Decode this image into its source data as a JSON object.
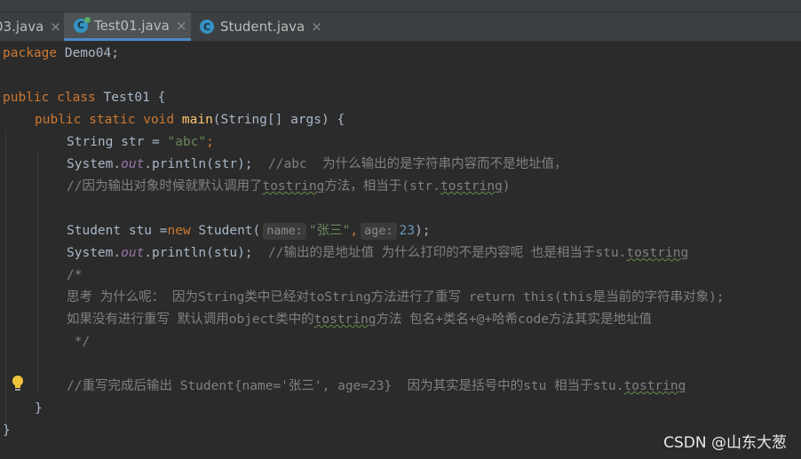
{
  "tabs": [
    {
      "label": "03.java",
      "active": false
    },
    {
      "label": "Test01.java",
      "active": true
    },
    {
      "label": "Student.java",
      "active": false
    }
  ],
  "close_glyph": "×",
  "code": {
    "l1": {
      "kw": "package",
      "rest": " Demo04;"
    },
    "l2": {
      "kw1": "public",
      "kw2": "class",
      "rest": " Test01 {"
    },
    "l3": {
      "kw": "public static void",
      "fn": "main",
      "rest": "(String[] args) {"
    },
    "l4": {
      "a": "String str = ",
      "s": "\"abc\"",
      "b": ";"
    },
    "l5": {
      "a": "System.",
      "f": "out",
      "b": ".println(str);  ",
      "c": "//abc  为什么输出的是字符串内容而不是地址值，"
    },
    "l6": {
      "a": "//因为输出对象时候就默认调用了",
      "w": "tostring",
      "b": "方法，相当于(str.",
      "w2": "tostring",
      "c": ")"
    },
    "l8": {
      "a": "Student stu =",
      "kw": "new",
      "b": " Student(",
      "h1": "name:",
      "s": "\"张三\"",
      "c": ",",
      "h2": "age:",
      "n": "23",
      "d": ");"
    },
    "l9": {
      "a": "System.",
      "f": "out",
      "b": ".println(stu);  ",
      "c": "//输出的是地址值 为什么打印的不是内容呢 也是相当于stu.",
      "w": "tostring"
    },
    "l10": "/*",
    "l11": "思考 为什么呢： 因为String类中已经对toString方法进行了重写 return this(this是当前的字符串对象);",
    "l12": {
      "a": "如果没有进行重写 默认调用object类中的",
      "w": "tostring",
      "b": "方法 包名+类名+@+哈希code方法其实是地址值"
    },
    "l13": " */",
    "l15": {
      "a": "//重写完成后输出 Student{name='张三', age=23}  因为其实是括号中的stu 相当于stu.",
      "w": "tostring"
    },
    "l16": "}",
    "l17": "}"
  },
  "watermark": "CSDN @山东大葱",
  "colors": {
    "background": "#2b2b2b",
    "keyword": "#cc7832",
    "string": "#6a8759",
    "comment": "#808080",
    "number": "#6897bb",
    "field": "#9876aa",
    "method": "#ffc66d"
  }
}
